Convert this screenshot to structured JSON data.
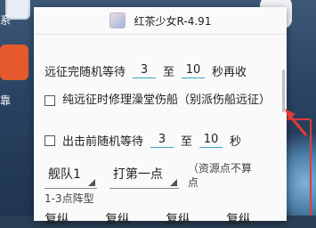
{
  "desktop": {
    "label_top": "系",
    "label_mid": "靠"
  },
  "dialog": {
    "title": "红茶少女R-4.91",
    "rows": {
      "expedition_wait": {
        "prefix": "远征完随机等待",
        "min": "3",
        "to": "至",
        "max": "10",
        "suffix": "秒再收"
      },
      "repair_option": {
        "text": "纯远征时修理澡堂伤船（别派伤船远征）"
      },
      "sortie_wait": {
        "prefix": "出击前随机等待",
        "min": "3",
        "to": "至",
        "max": "10",
        "suffix": "秒"
      }
    },
    "fleet_select": "舰队1",
    "target_select": "打第一点",
    "resource_note": "（资源点不算点",
    "formation_section": "1-3点阵型",
    "formation_values": [
      "复纵",
      "复纵",
      "复纵",
      "复纵"
    ]
  },
  "colors": {
    "accent": "#38a0c8",
    "annotation_red": "#e23b3b"
  }
}
